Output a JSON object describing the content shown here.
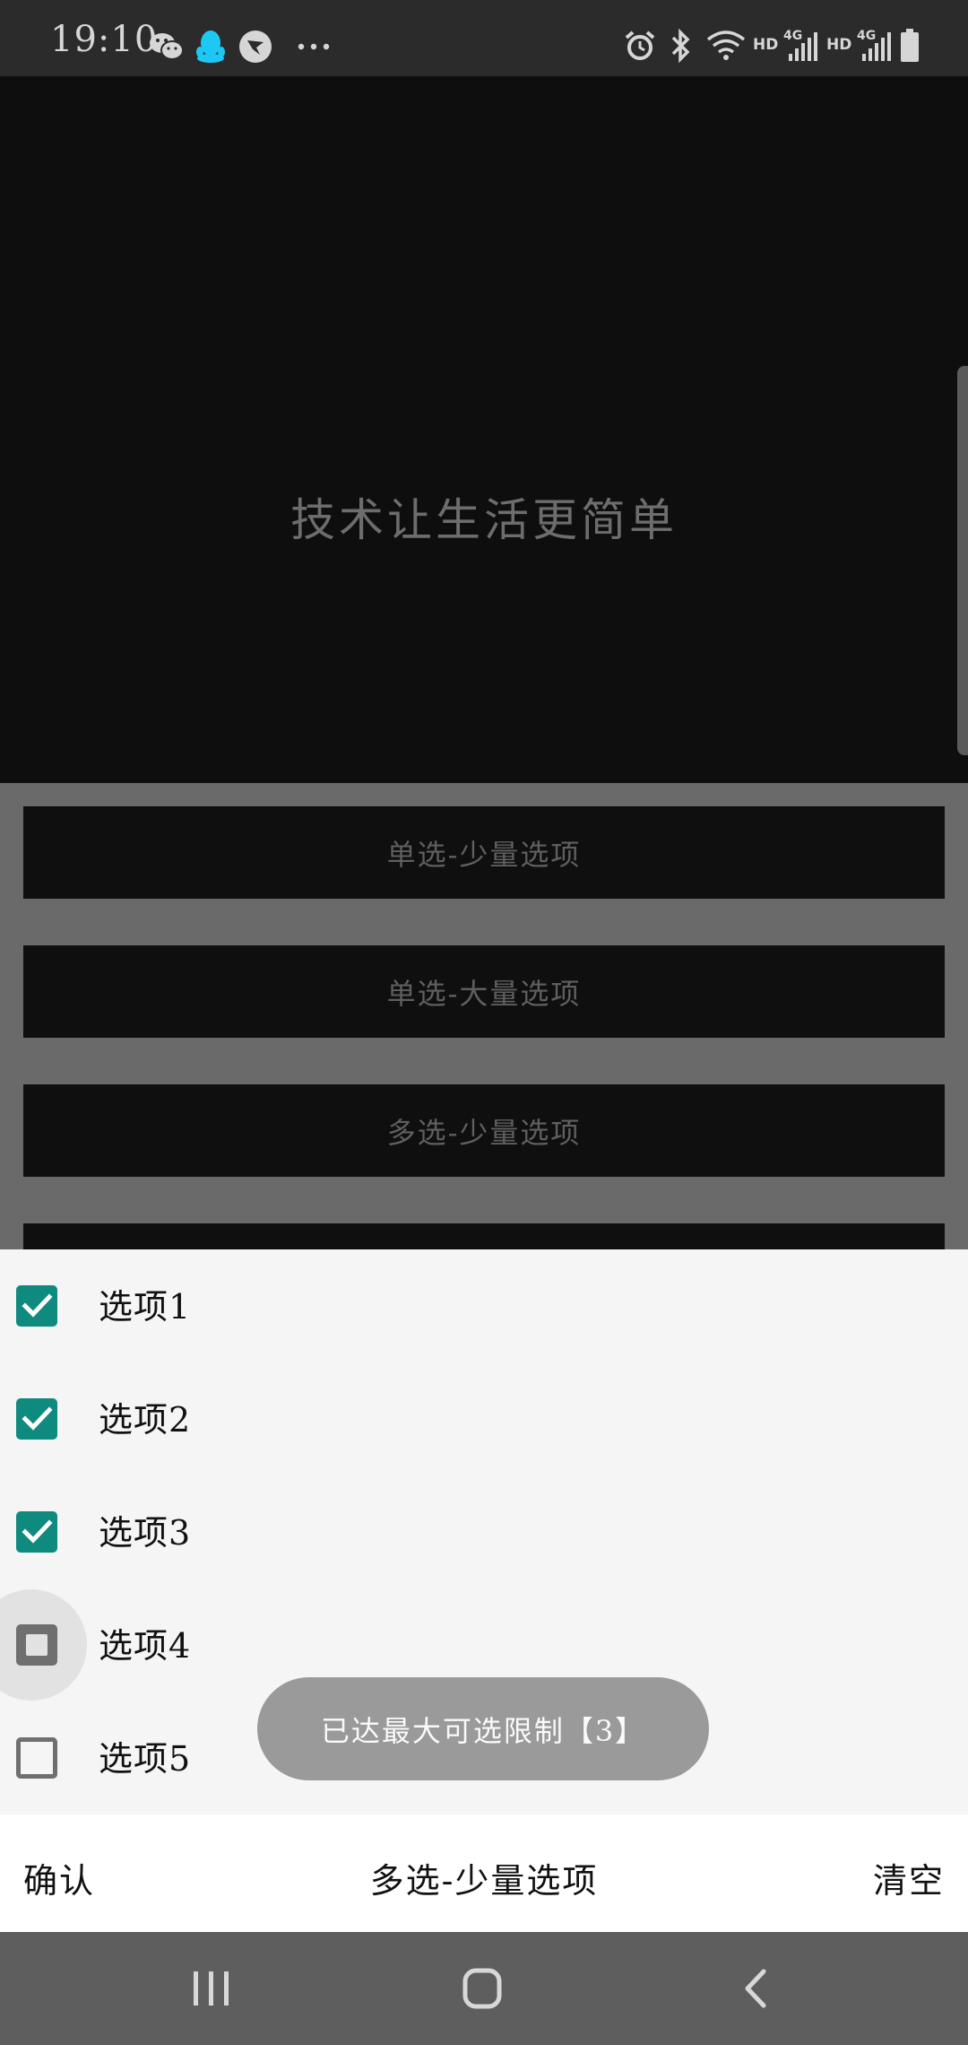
{
  "status_bar": {
    "time": "19:10",
    "notification_icons": [
      "wechat-icon",
      "qq-icon",
      "feishu-icon",
      "more-dots-icon"
    ],
    "system_icons": [
      "alarm-icon",
      "bluetooth-icon",
      "wifi-icon",
      "hd-signal-icon",
      "4g-signal-icon",
      "hd-signal-icon",
      "4g-signal-icon",
      "battery-icon"
    ],
    "hd_label": "HD",
    "net_label": "4G"
  },
  "hero": {
    "slogan": "技术让生活更简单"
  },
  "menu": {
    "items": [
      {
        "label": "单选-少量选项"
      },
      {
        "label": "单选-大量选项"
      },
      {
        "label": "多选-少量选项"
      },
      {
        "label": ""
      }
    ]
  },
  "sheet": {
    "options": [
      {
        "label": "选项1",
        "state": "checked"
      },
      {
        "label": "选项2",
        "state": "checked"
      },
      {
        "label": "选项3",
        "state": "checked"
      },
      {
        "label": "选项4",
        "state": "pressed"
      },
      {
        "label": "选项5",
        "state": "unchecked"
      }
    ]
  },
  "toast": {
    "text": "已达最大可选限制【3】"
  },
  "action_bar": {
    "confirm_label": "确认",
    "title": "多选-少量选项",
    "clear_label": "清空"
  },
  "nav_bar": {
    "buttons": [
      "recents-icon",
      "home-icon",
      "back-icon"
    ]
  },
  "colors": {
    "accent": "#0f8a7e",
    "scrim": "#6a6a6a",
    "sheet_bg": "#f5f5f5",
    "toast_bg": "#9a9a9a"
  }
}
